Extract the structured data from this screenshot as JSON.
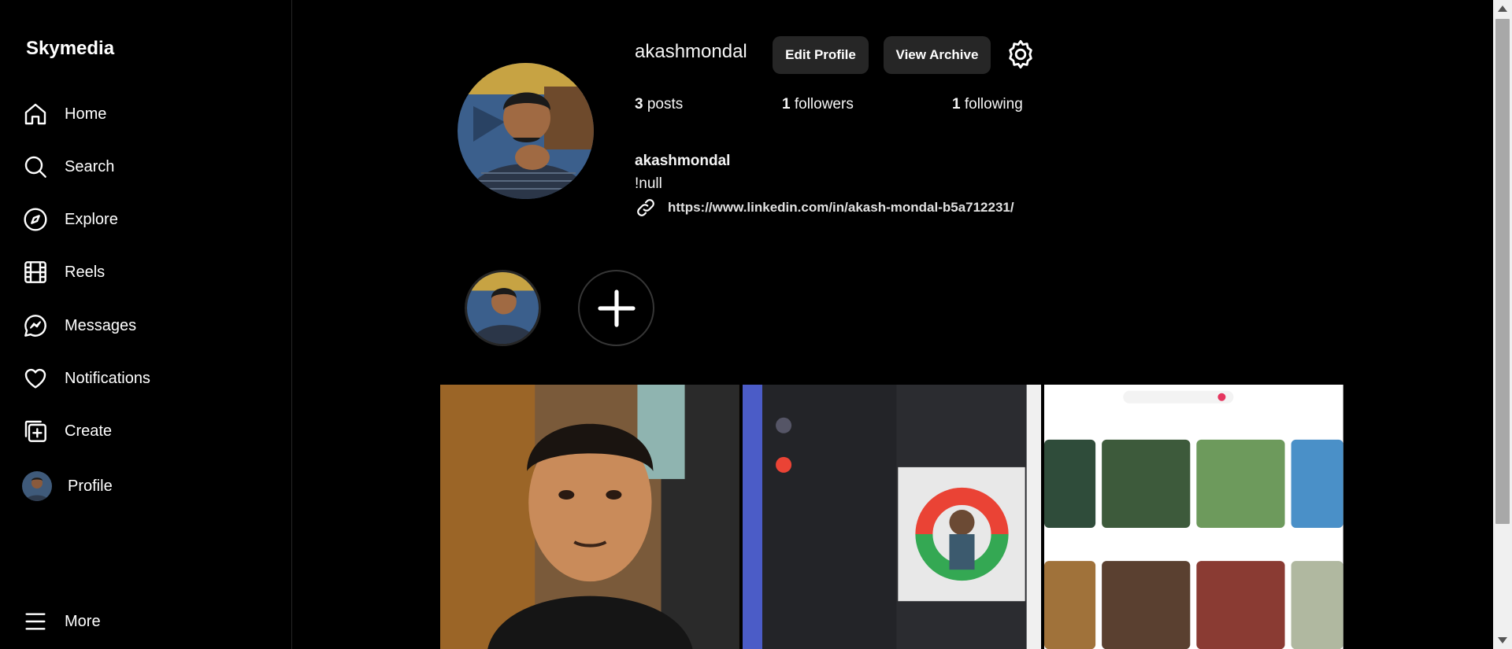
{
  "sidebar": {
    "brand": "Skymedia",
    "items": [
      {
        "label": "Home",
        "icon": "home-icon"
      },
      {
        "label": "Search",
        "icon": "search-icon"
      },
      {
        "label": "Explore",
        "icon": "compass-icon"
      },
      {
        "label": "Reels",
        "icon": "film-icon"
      },
      {
        "label": "Messages",
        "icon": "message-icon"
      },
      {
        "label": "Notifications",
        "icon": "heart-icon"
      },
      {
        "label": "Create",
        "icon": "plus-square-icon"
      },
      {
        "label": "Profile",
        "icon": "avatar"
      }
    ],
    "more": "More"
  },
  "profile": {
    "username": "akashmondal",
    "edit_label": "Edit Profile",
    "archive_label": "View Archive",
    "stats": {
      "posts_count": "3",
      "posts_label": " posts",
      "followers_count": "1",
      "followers_label": " followers",
      "following_count": "1",
      "following_label": " following"
    },
    "bio_name": "akashmondal",
    "bio_text": "!null",
    "bio_link": "https://www.linkedin.com/in/akash-mondal-b5a712231/"
  },
  "posts": [
    {
      "kind": "portrait-photo"
    },
    {
      "kind": "status-app-screenshot"
    },
    {
      "kind": "travel-app-screenshot"
    }
  ],
  "colors": {
    "background": "#000000",
    "button": "#262626",
    "text": "#f5f5f5"
  }
}
